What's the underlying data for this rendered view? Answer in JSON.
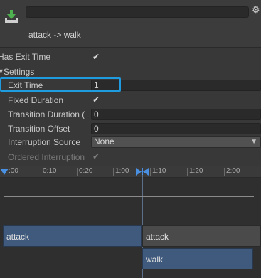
{
  "header": {
    "title": "attack -> walk",
    "name_value": ""
  },
  "rows": {
    "has_exit_time": "Has Exit Time",
    "settings": "Settings",
    "exit_time": "Exit Time",
    "exit_time_value": "1",
    "fixed_duration": "Fixed Duration",
    "transition_duration": "Transition Duration (",
    "transition_duration_value": "0",
    "transition_offset": "Transition Offset",
    "transition_offset_value": "0",
    "interruption_source": "Interruption Source",
    "interruption_source_value": "None",
    "ordered_interruption": "Ordered Interruption"
  },
  "timeline": {
    "ticks": [
      ":00",
      "0:10",
      "0:20",
      "1:00",
      "1:10",
      "1:20",
      "2:00"
    ],
    "source_state": "attack",
    "next_state": "attack",
    "destination_state": "walk"
  },
  "icons": {
    "transition": "transition-icon",
    "gear": "gear-icon",
    "check": "checkmark-icon",
    "foldout": "foldout-arrow-icon",
    "dropdown": "dropdown-arrow-icon"
  },
  "colors": {
    "highlight": "#1f9ce0",
    "state_bar": "#3f5a7d",
    "marker": "#4a90e2"
  }
}
